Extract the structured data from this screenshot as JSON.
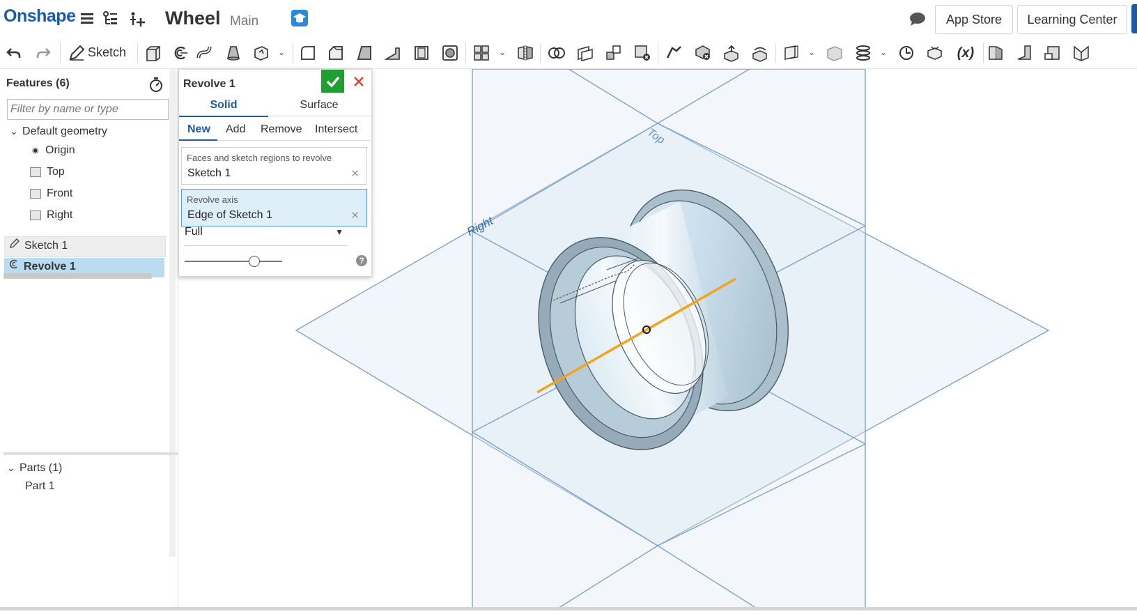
{
  "header": {
    "logo": "Onshape",
    "document_title": "Wheel",
    "branch": "Main",
    "app_store_label": "App Store",
    "learning_center_label": "Learning Center"
  },
  "toolbar": {
    "sketch_label": "Sketch",
    "active_tool": "revolve-icon",
    "highlight_color": "#f6f600",
    "accent_color": "#1d5aa6"
  },
  "features_panel": {
    "title": "Features (6)",
    "filter_placeholder": "Filter by name or type",
    "default_geometry_label": "Default geometry",
    "default_items": [
      "Origin",
      "Top",
      "Front",
      "Right"
    ],
    "sketch_item": "Sketch 1",
    "revolve_item": "Revolve 1",
    "parts_label": "Parts (1)",
    "part_item": "Part 1"
  },
  "dialog": {
    "title": "Revolve 1",
    "tabs": [
      "Solid",
      "Surface"
    ],
    "operations": [
      "New",
      "Add",
      "Remove",
      "Intersect"
    ],
    "faces_field": {
      "label": "Faces and sketch regions to revolve",
      "value": "Sketch 1"
    },
    "axis_field": {
      "label": "Revolve axis",
      "value": "Edge of Sketch 1"
    },
    "revolve_type": "Full",
    "help": "?"
  },
  "viewport": {
    "plane_top_label": "Top",
    "plane_right_label": "Right",
    "axis_color": "#f4a41a",
    "part_color": "#c9dde8"
  }
}
